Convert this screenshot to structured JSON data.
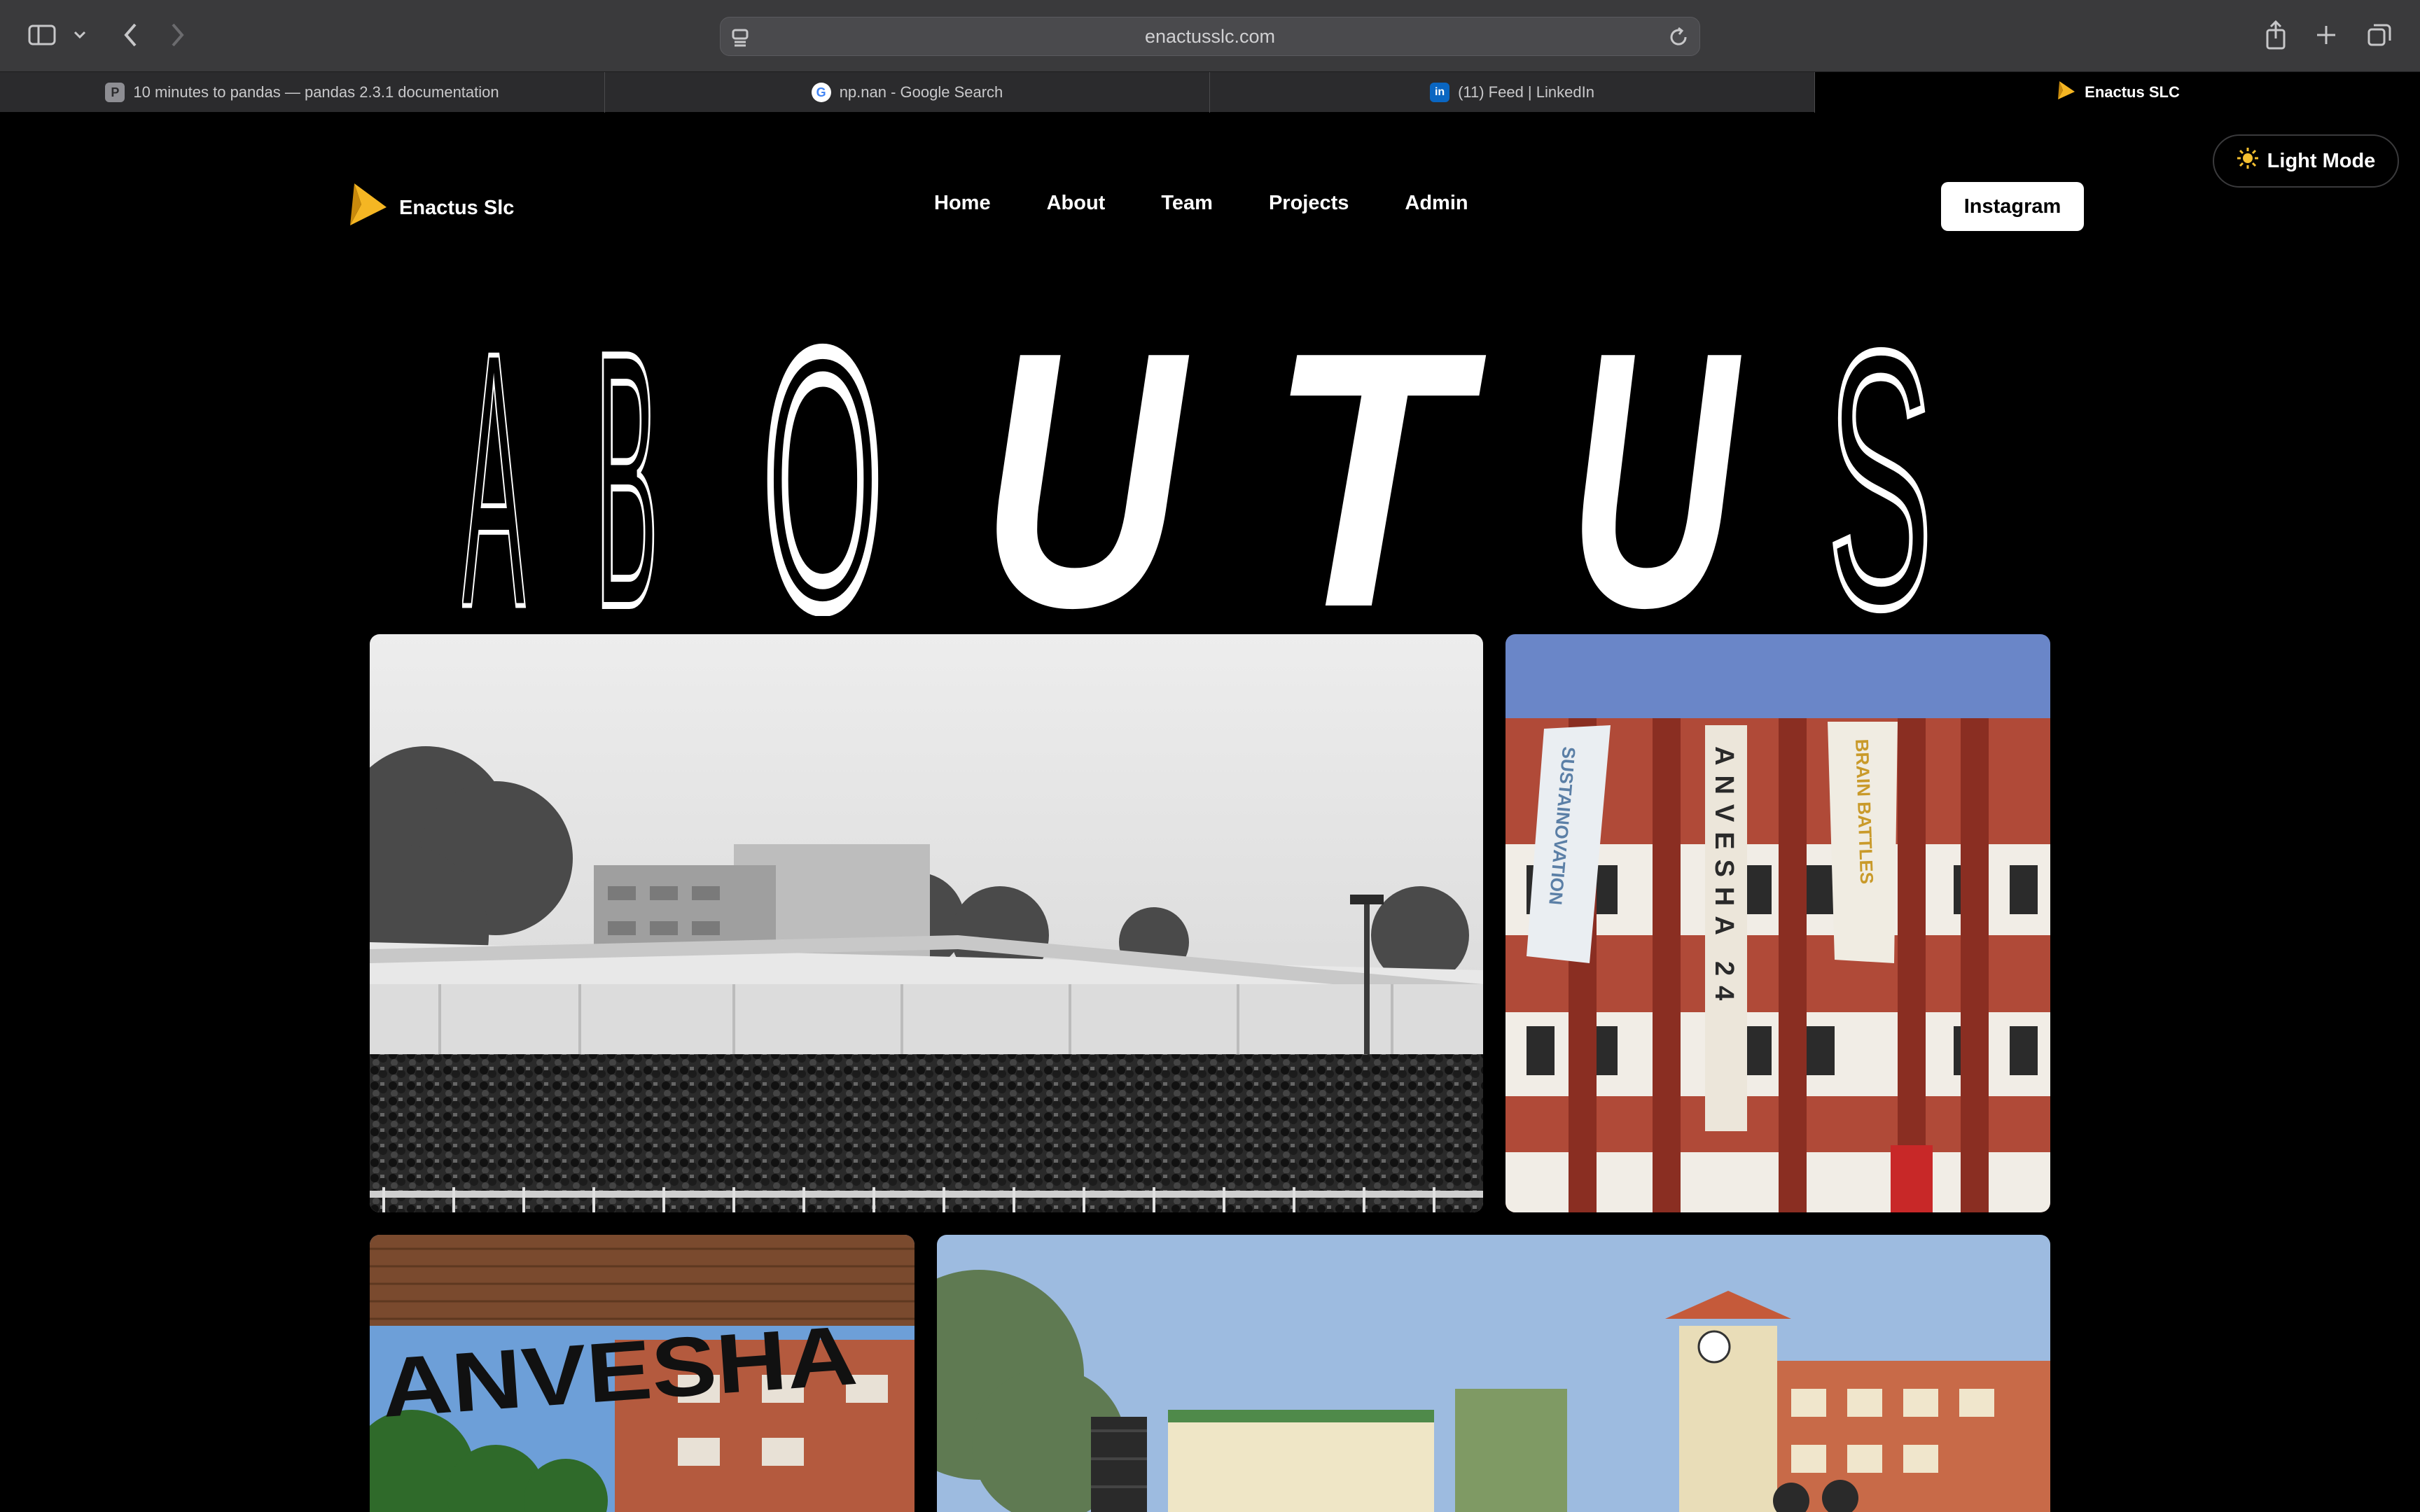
{
  "browser": {
    "url": "enactusslc.com",
    "tabs": [
      {
        "title": "10 minutes to pandas — pandas 2.3.1 documentation",
        "favicon": "pandas-favicon",
        "favicon_letter": "P"
      },
      {
        "title": "np.nan - Google Search",
        "favicon": "google-favicon",
        "favicon_letter": "G"
      },
      {
        "title": "(11) Feed | LinkedIn",
        "favicon": "linkedin-favicon",
        "favicon_letter": "in"
      },
      {
        "title": "Enactus SLC",
        "favicon": "enactus-favicon",
        "active": true
      }
    ]
  },
  "theme_toggle": {
    "label": "Light Mode",
    "icon": "sun-icon"
  },
  "nav": {
    "brand": "Enactus Slc",
    "links": [
      "Home",
      "About",
      "Team",
      "Projects",
      "Admin"
    ],
    "cta": "Instagram"
  },
  "hero": {
    "letters": [
      "A",
      "B",
      "O",
      "U",
      "T",
      "U",
      "S"
    ]
  },
  "gallery": {
    "photos": [
      {
        "name": "crowd-event-photo",
        "description_label": ""
      },
      {
        "name": "anvesha-banners-photo",
        "banner_texts": [
          "SUSTAINOVATION",
          "ANVESHA 24",
          "BRAIN BATTLES"
        ]
      },
      {
        "name": "anvesha-sign-photo",
        "sign_text": "ANVESHA"
      },
      {
        "name": "campus-clocktower-photo"
      }
    ]
  },
  "colors": {
    "accent": "#f5b623",
    "background": "#000000",
    "toolbar": "#3a3a3c"
  }
}
